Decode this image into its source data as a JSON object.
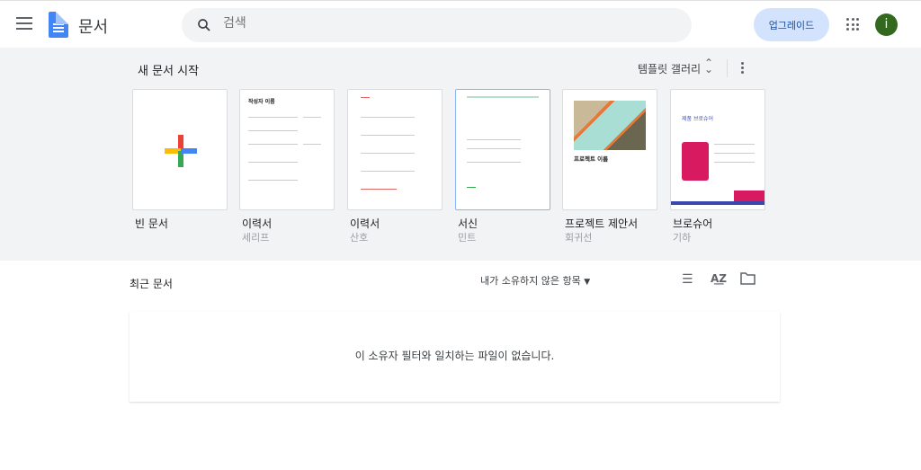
{
  "header": {
    "app_title": "문서",
    "search_placeholder": "검색",
    "upgrade_label": "업그레이드",
    "avatar_letter": "i"
  },
  "templates": {
    "title": "새 문서 시작",
    "gallery_label": "템플릿 갤러리",
    "items": [
      {
        "label": "빈 문서",
        "sub": ""
      },
      {
        "label": "이력서",
        "sub": "세리프",
        "preview_title": "작성자 이름"
      },
      {
        "label": "이력서",
        "sub": "산호"
      },
      {
        "label": "서신",
        "sub": "민트"
      },
      {
        "label": "프로젝트 제안서",
        "sub": "회귀선",
        "preview_title": "프로젝트 이름"
      },
      {
        "label": "브로슈어",
        "sub": "기하",
        "preview_title": "제품 브로슈어"
      }
    ]
  },
  "recent": {
    "title": "최근 문서",
    "owner_filter": "내가 소유하지 않은 항목",
    "empty_message": "이 소유자 필터와 일치하는 파일이 없습니다."
  },
  "colors": {
    "band": "#f1f3f4",
    "upgrade_bg": "#d3e3fd",
    "avatar": "#33691e",
    "docs_blue": "#4285f4"
  }
}
